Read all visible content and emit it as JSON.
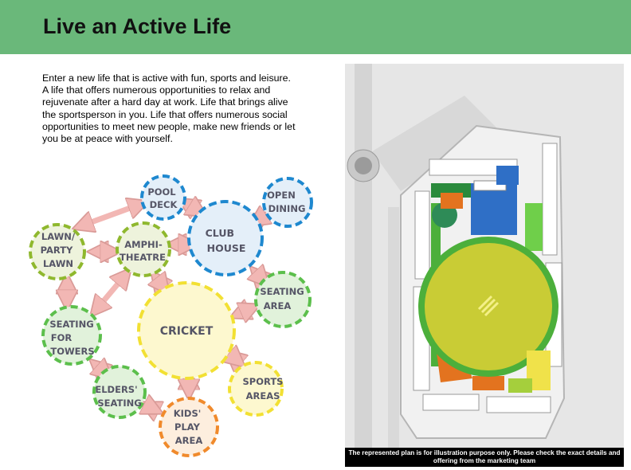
{
  "header": {
    "title": "Live an Active Life"
  },
  "intro": {
    "text": "Enter a new life that is active with fun, sports and leisure. A life that offers numerous opportunities to relax and rejuvenate after a hard day at work. Life that brings alive the sportsperson in you. Life that offers numerous social opportunities to meet new people, make new friends or let you be at peace with yourself."
  },
  "diagram": {
    "nodes": {
      "pool_deck": [
        "POOL",
        "DECK"
      ],
      "open_dining": [
        "OPEN",
        "DINING"
      ],
      "club_house": [
        "CLUB",
        "HOUSE"
      ],
      "lawn": [
        "LAWN/",
        "PARTY",
        "LAWN"
      ],
      "amphitheatre": [
        "AMPHI-",
        "THEATRE"
      ],
      "seating_area": [
        "SEATING",
        "AREA"
      ],
      "cricket": [
        "CRICKET"
      ],
      "seating_towers": [
        "SEATING",
        "FOR",
        "TOWERS"
      ],
      "elders_seating": [
        "ELDERS'",
        "SEATING"
      ],
      "sports_areas": [
        "SPORTS",
        "AREAS"
      ],
      "kids_play": [
        "KIDS'",
        "PLAY",
        "AREA"
      ]
    },
    "colors": {
      "blue": "#1e88cf",
      "green": "#5cbf4c",
      "lime": "#8fb82e",
      "yellow": "#f2e033",
      "orange": "#f08a2c",
      "arrow": "#f2b7b4"
    }
  },
  "map": {
    "caption": "The represented plan is for illustration purpose only. Please check the exact details and offering from the marketing team"
  }
}
